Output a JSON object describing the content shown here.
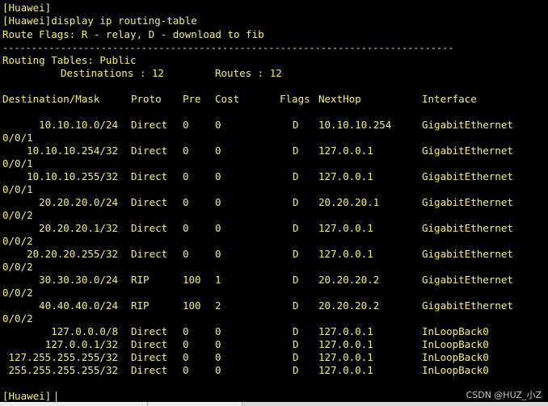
{
  "terminal": {
    "prompt_top": "[Huawei]",
    "command": "[Huawei]display ip routing-table",
    "flags_line": "Route Flags: R - relay, D - download to fib",
    "separator": "------------------------------------------------------------------------------",
    "routing_tables": "Routing Tables: Public",
    "destinations_label": "Destinations : 12",
    "routes_label": "Routes : 12",
    "headers": {
      "dest": "Destination/Mask",
      "proto": "Proto",
      "pre": "Pre",
      "cost": "Cost",
      "flags": "Flags",
      "nexthop": "NextHop",
      "iface": "Interface"
    },
    "routes": [
      {
        "dest": "10.10.10.0/24",
        "proto": "Direct",
        "pre": "0",
        "cost": "0",
        "flags": "D",
        "nexthop": "10.10.10.254",
        "iface": "GigabitEthernet",
        "wrap": "0/0/1"
      },
      {
        "dest": "10.10.10.254/32",
        "proto": "Direct",
        "pre": "0",
        "cost": "0",
        "flags": "D",
        "nexthop": "127.0.0.1",
        "iface": "GigabitEthernet",
        "wrap": "0/0/1"
      },
      {
        "dest": "10.10.10.255/32",
        "proto": "Direct",
        "pre": "0",
        "cost": "0",
        "flags": "D",
        "nexthop": "127.0.0.1",
        "iface": "GigabitEthernet",
        "wrap": "0/0/1"
      },
      {
        "dest": "20.20.20.0/24",
        "proto": "Direct",
        "pre": "0",
        "cost": "0",
        "flags": "D",
        "nexthop": "20.20.20.1",
        "iface": "GigabitEthernet",
        "wrap": "0/0/2"
      },
      {
        "dest": "20.20.20.1/32",
        "proto": "Direct",
        "pre": "0",
        "cost": "0",
        "flags": "D",
        "nexthop": "127.0.0.1",
        "iface": "GigabitEthernet",
        "wrap": "0/0/2"
      },
      {
        "dest": "20.20.20.255/32",
        "proto": "Direct",
        "pre": "0",
        "cost": "0",
        "flags": "D",
        "nexthop": "127.0.0.1",
        "iface": "GigabitEthernet",
        "wrap": "0/0/2"
      },
      {
        "dest": "30.30.30.0/24",
        "proto": "RIP",
        "pre": "100",
        "cost": "1",
        "flags": "D",
        "nexthop": "20.20.20.2",
        "iface": "GigabitEthernet",
        "wrap": "0/0/2"
      },
      {
        "dest": "40.40.40.0/24",
        "proto": "RIP",
        "pre": "100",
        "cost": "2",
        "flags": "D",
        "nexthop": "20.20.20.2",
        "iface": "GigabitEthernet",
        "wrap": "0/0/2"
      },
      {
        "dest": "127.0.0.0/8",
        "proto": "Direct",
        "pre": "0",
        "cost": "0",
        "flags": "D",
        "nexthop": "127.0.0.1",
        "iface": "InLoopBack0",
        "wrap": ""
      },
      {
        "dest": "127.0.0.1/32",
        "proto": "Direct",
        "pre": "0",
        "cost": "0",
        "flags": "D",
        "nexthop": "127.0.0.1",
        "iface": "InLoopBack0",
        "wrap": ""
      },
      {
        "dest": "127.255.255.255/32",
        "proto": "Direct",
        "pre": "0",
        "cost": "0",
        "flags": "D",
        "nexthop": "127.0.0.1",
        "iface": "InLoopBack0",
        "wrap": ""
      },
      {
        "dest": "255.255.255.255/32",
        "proto": "Direct",
        "pre": "0",
        "cost": "0",
        "flags": "D",
        "nexthop": "127.0.0.1",
        "iface": "InLoopBack0",
        "wrap": ""
      }
    ],
    "prompt_bottom": "[Huawei]"
  },
  "watermark": "CSDN @HUZ_小Z",
  "colors": {
    "background": "#000000",
    "text": "#f0f080"
  }
}
